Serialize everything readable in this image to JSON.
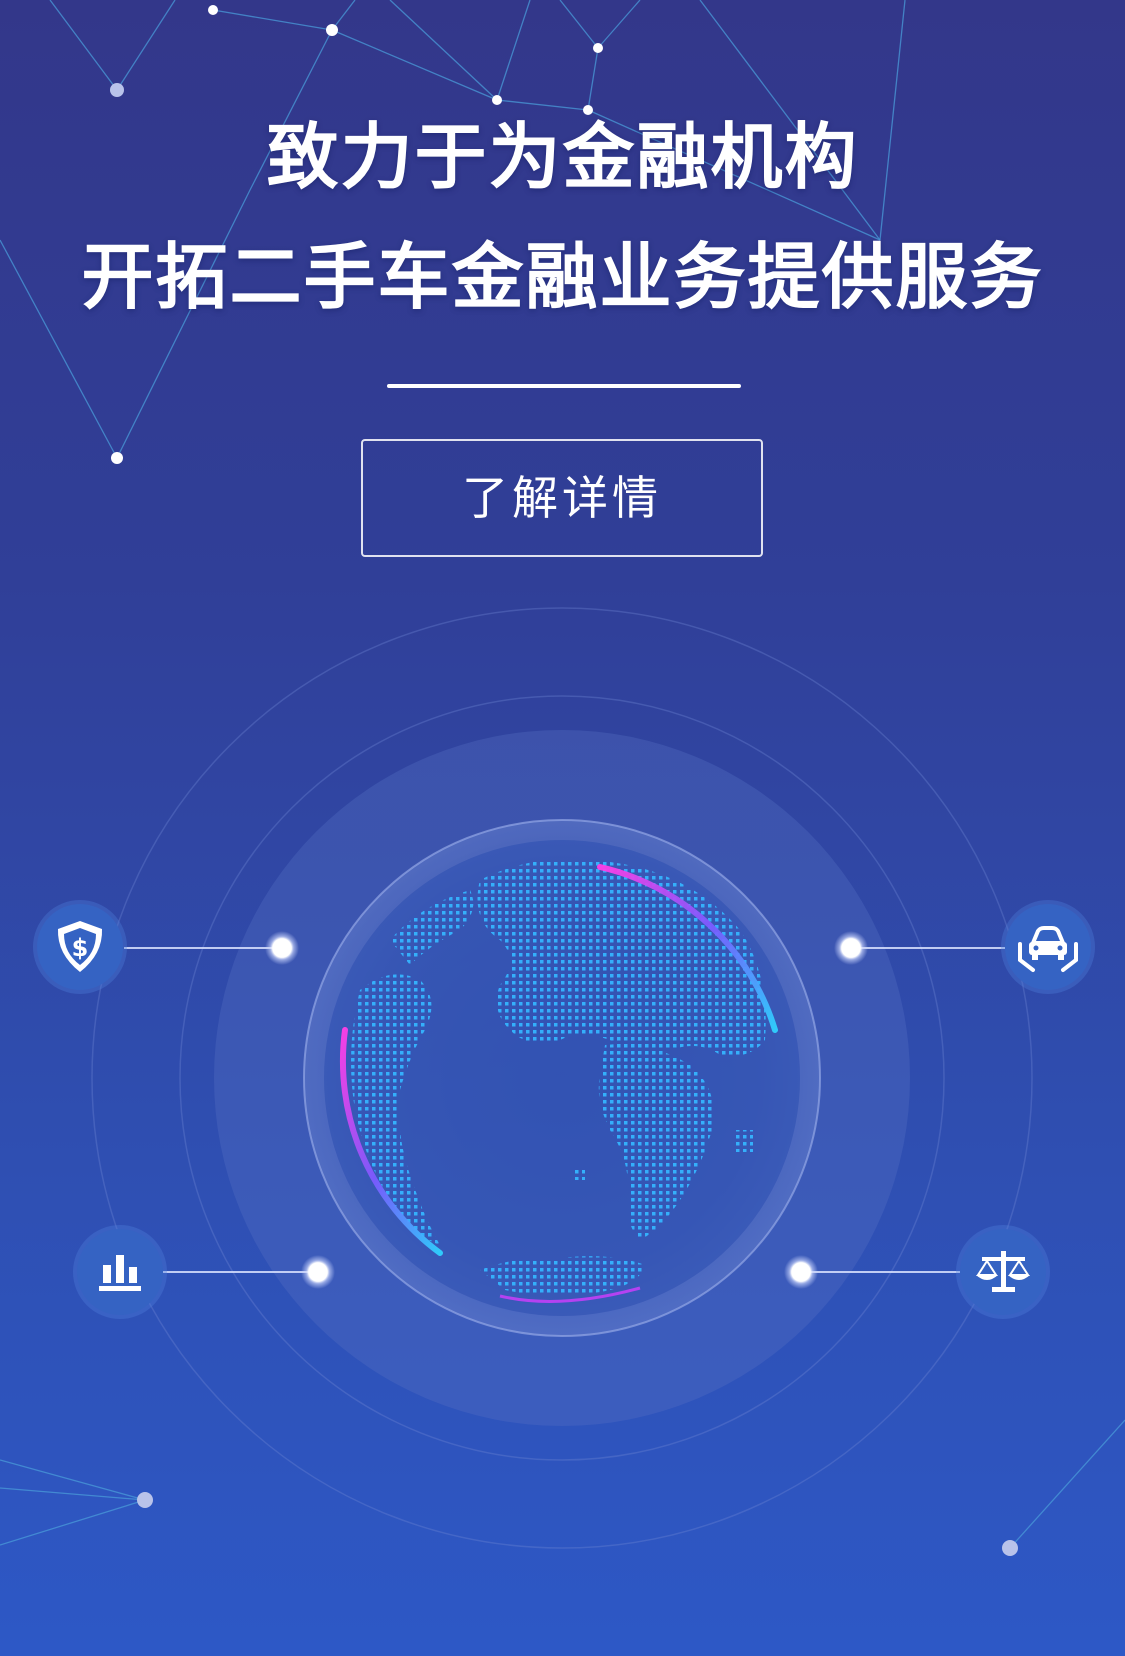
{
  "hero": {
    "headline_line1": "致力于为金融机构",
    "headline_line2": "开拓二手车金融业务提供服务",
    "cta_label": "了解详情"
  },
  "features": [
    {
      "id": "security",
      "icon": "shield-dollar-icon"
    },
    {
      "id": "car-protection",
      "icon": "car-in-hands-icon"
    },
    {
      "id": "analytics",
      "icon": "bar-chart-icon"
    },
    {
      "id": "compliance",
      "icon": "balance-scale-icon"
    }
  ],
  "colors": {
    "background_top": "#33378a",
    "background_bottom": "#2d58c6",
    "icon_circle": "#3563c3",
    "globe_cyan": "#2fb0ff",
    "globe_magenta": "#d33cff",
    "text": "#ffffff"
  }
}
